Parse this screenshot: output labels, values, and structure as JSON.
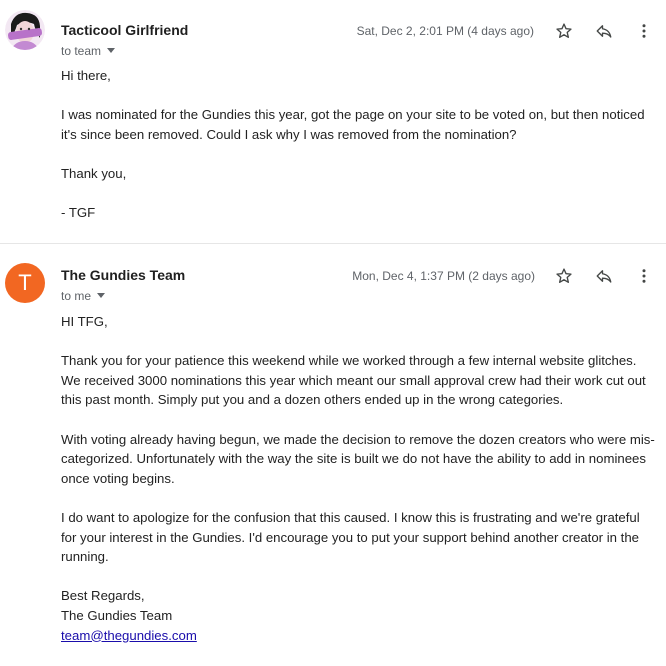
{
  "messages": [
    {
      "sender": "Tacticool Girlfriend",
      "recipient": "to team",
      "timestamp": "Sat, Dec 2, 2:01 PM (4 days ago)",
      "avatar_icon": "profile-photo-avatar",
      "body": {
        "greeting": "Hi there,",
        "paragraph1": "I was nominated for the Gundies this year, got the page on your site to be voted on, but then noticed it's since been removed. Could I ask why I was removed from the nomination?",
        "thanks": "Thank you,",
        "signature": "- TGF"
      }
    },
    {
      "sender": "The Gundies Team",
      "recipient": "to me",
      "timestamp": "Mon, Dec 4, 1:37 PM (2 days ago)",
      "avatar_letter": "T",
      "avatar_color": "#f26722",
      "body": {
        "greeting": "HI TFG,",
        "paragraph1": "Thank you for your patience this weekend while we worked through a few internal website glitches. We received 3000 nominations this year which meant our small approval crew had their work cut out this past month. Simply put you and a dozen others ended up in the wrong categories.",
        "paragraph2": "With voting already having begun, we made the decision to remove the dozen creators who were mis-categorized. Unfortunately with the way the site is built we do not have the ability to add in nominees once voting begins.",
        "paragraph3": "I do want to apologize for the confusion that this caused. I know this is frustrating and we're grateful for your interest in the Gundies. I'd encourage you to put your support behind another creator in the running.",
        "closing": "Best Regards,",
        "signature_name": "The Gundies Team",
        "email": "team@thegundies.com"
      }
    }
  ],
  "icons": {
    "star": "star-icon",
    "reply": "reply-icon",
    "more": "more-vert-icon",
    "dropdown": "chevron-down-icon"
  }
}
